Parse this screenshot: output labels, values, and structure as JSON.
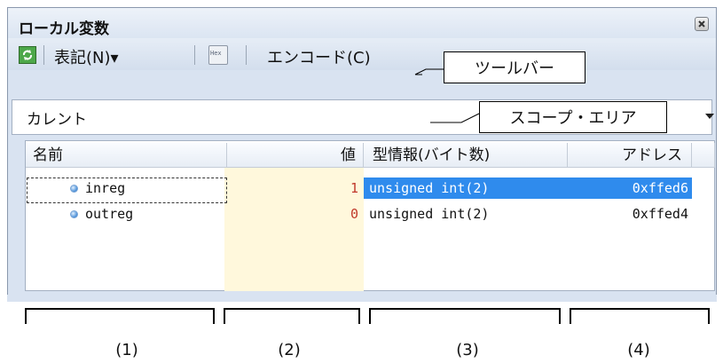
{
  "window": {
    "title": "ローカル変数"
  },
  "toolbar": {
    "notation_label": "表記(N)▾",
    "hex_icon_text": "Hex",
    "encode_label": "エンコード(C)"
  },
  "callouts": {
    "toolbar": "ツールバー",
    "scope_area": "スコープ・エリア"
  },
  "scope": {
    "value": "カレント"
  },
  "grid": {
    "columns": [
      "名前",
      "値",
      "型情報(バイト数)",
      "アドレス"
    ],
    "rows": [
      {
        "name": "inreg",
        "value": "1",
        "type": "unsigned int(2)",
        "address": "0xffed6",
        "selected": true
      },
      {
        "name": "outreg",
        "value": "0",
        "type": "unsigned int(2)",
        "address": "0xffed4",
        "selected": false
      }
    ]
  },
  "annotations": [
    "(1)",
    "(2)",
    "(3)",
    "(4)"
  ],
  "colors": {
    "selection": "#2f8bed",
    "value_bg": "#fff8dc",
    "value_text": "#c0392b"
  }
}
